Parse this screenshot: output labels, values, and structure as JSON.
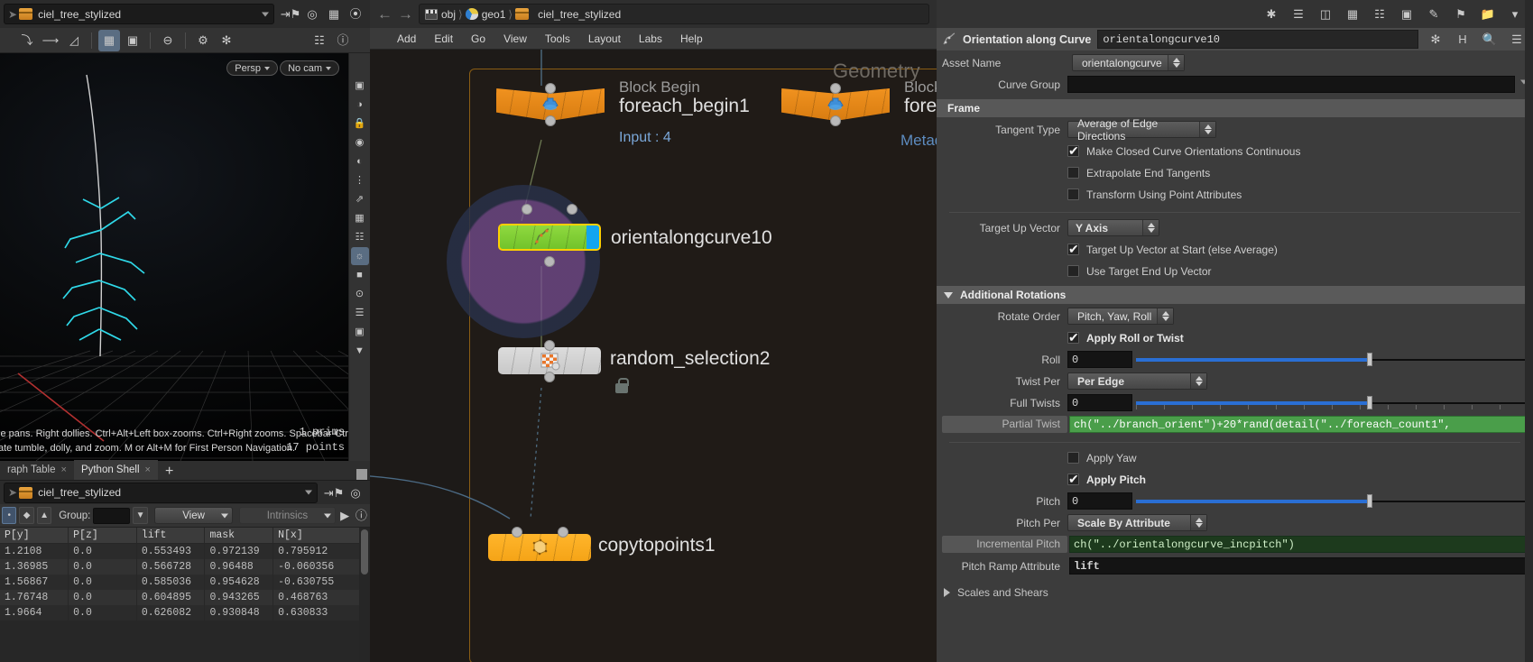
{
  "viewport_pane": {
    "path": {
      "value": "ciel_tree_stylized",
      "icon": "box-icon"
    },
    "toolbar_icons": [
      "select-tool-icon",
      "rotate-tool-icon",
      "scale-tool-icon",
      "view-layout-icon",
      "snapshot-icon",
      "no-entry-icon",
      "handles-icon",
      "gear-icon",
      "display-options-icon"
    ],
    "camera_chip": "Persp",
    "cam_chip": "No cam",
    "hud_line1": "le pans. Right dollies. Ctrl+Alt+Left box-zooms. Ctrl+Right zooms. Spacebar-Ctrl",
    "hud_line2": "ate tumble, dolly, and zoom.    M or Alt+M for First Person Navigation.",
    "stat_prims": "1 prims",
    "stat_points": "17 points"
  },
  "bottom_pane": {
    "tabs": [
      {
        "label": "raph Table",
        "active": false,
        "close": "×"
      },
      {
        "label": "Python Shell",
        "active": true,
        "close": "×"
      }
    ],
    "add_tab": "+",
    "path": {
      "value": "ciel_tree_stylized"
    },
    "toolbar": {
      "group_label": "Group:",
      "group_value": "",
      "view_label": "View",
      "intrinsics_label": "Intrinsics"
    },
    "table": {
      "columns": [
        "P[y]",
        "P[z]",
        "lift",
        "mask",
        "N[x]"
      ],
      "rows": [
        [
          "1.2108",
          "0.0",
          "0.553493",
          "0.972139",
          "0.795912"
        ],
        [
          "1.36985",
          "0.0",
          "0.566728",
          "0.96488",
          "-0.060356"
        ],
        [
          "1.56867",
          "0.0",
          "0.585036",
          "0.954628",
          "-0.630755"
        ],
        [
          "1.76748",
          "0.0",
          "0.604895",
          "0.943265",
          "0.468763"
        ],
        [
          "1.9664",
          "0.0",
          "0.626082",
          "0.930848",
          "0.630833"
        ]
      ]
    }
  },
  "network_editor": {
    "breadcrumbs": [
      {
        "label": "obj",
        "icon": "clapperboard-icon"
      },
      {
        "label": "geo1",
        "icon": "geometry-icon"
      },
      {
        "label": "ciel_tree_stylized",
        "icon": "box-icon"
      }
    ],
    "menus": [
      "Add",
      "Edit",
      "Go",
      "View",
      "Tools",
      "Layout",
      "Labs",
      "Help"
    ],
    "toolbar_icons": [
      "tools-icon",
      "list-tree-icon",
      "layers-icon",
      "color-palette-icon",
      "grid-icon",
      "snapshot-icon",
      "note-icon",
      "flag-icon",
      "folder-icon"
    ],
    "canvas_labels": {
      "geometry": "Geometry",
      "metadata": "Metad"
    },
    "nodes": [
      {
        "name": "foreach_begin1",
        "subtitle": "Block Begin",
        "info": "Input : 4",
        "type": "orange"
      },
      {
        "name": "forea",
        "subtitle": "Block",
        "info": "",
        "type": "orange"
      },
      {
        "name": "orientalongcurve10",
        "subtitle": "",
        "info": "",
        "type": "green-selected"
      },
      {
        "name": "random_selection2",
        "subtitle": "",
        "info": "",
        "type": "grey",
        "locked": true
      },
      {
        "name": "copytopoints1",
        "subtitle": "",
        "info": "",
        "type": "amber"
      }
    ]
  },
  "parameters": {
    "header": {
      "title": "Orientation along Curve",
      "node_name": "orientalongcurve10",
      "icons": [
        "gear-icon",
        "houdini-h-icon",
        "search-icon",
        "menu-icon"
      ]
    },
    "asset_name_label": "Asset Name",
    "asset_name_value": "orientalongcurve",
    "curve_group_label": "Curve Group",
    "curve_group_value": "",
    "frame_section": "Frame",
    "tangent_type_label": "Tangent Type",
    "tangent_type_value": "Average of Edge Directions",
    "checkbox_closed_curve": {
      "label": "Make Closed Curve Orientations Continuous",
      "checked": true
    },
    "checkbox_extrapolate": {
      "label": "Extrapolate End Tangents",
      "checked": false
    },
    "checkbox_transform_pt": {
      "label": "Transform Using Point Attributes",
      "checked": false
    },
    "target_up_label": "Target Up Vector",
    "target_up_value": "Y Axis",
    "checkbox_up_at_start": {
      "label": "Target Up Vector at Start (else Average)",
      "checked": true
    },
    "checkbox_end_up": {
      "label": "Use Target End Up Vector",
      "checked": false
    },
    "additional_rotations": "Additional Rotations",
    "rotate_order_label": "Rotate Order",
    "rotate_order_value": "Pitch, Yaw, Roll",
    "checkbox_roll_twist": {
      "label": "Apply Roll or Twist",
      "checked": true
    },
    "roll_label": "Roll",
    "roll_value": "0",
    "twist_per_label": "Twist Per",
    "twist_per_value": "Per Edge",
    "full_twists_label": "Full Twists",
    "full_twists_value": "0",
    "partial_twist_label": "Partial Twist",
    "partial_twist_value": "ch(\"../branch_orient\")+20*rand(detail(\"../foreach_count1\",",
    "checkbox_apply_yaw": {
      "label": "Apply Yaw",
      "checked": false
    },
    "checkbox_apply_pitch": {
      "label": "Apply Pitch",
      "checked": true
    },
    "pitch_label": "Pitch",
    "pitch_value": "0",
    "pitch_per_label": "Pitch Per",
    "pitch_per_value": "Scale By Attribute",
    "incremental_pitch_label": "Incremental Pitch",
    "incremental_pitch_value": "ch(\"../orientalongcurve_incpitch\")",
    "pitch_ramp_label": "Pitch Ramp Attribute",
    "pitch_ramp_value": "lift",
    "scales_and_shears": "Scales and Shears",
    "colors": {
      "expression_green": "#4a9e4a",
      "expression_dark_green": "#1d3a1d",
      "slider_blue": "#2a6fd4",
      "selected_node_yellow": "#ffd000"
    }
  }
}
